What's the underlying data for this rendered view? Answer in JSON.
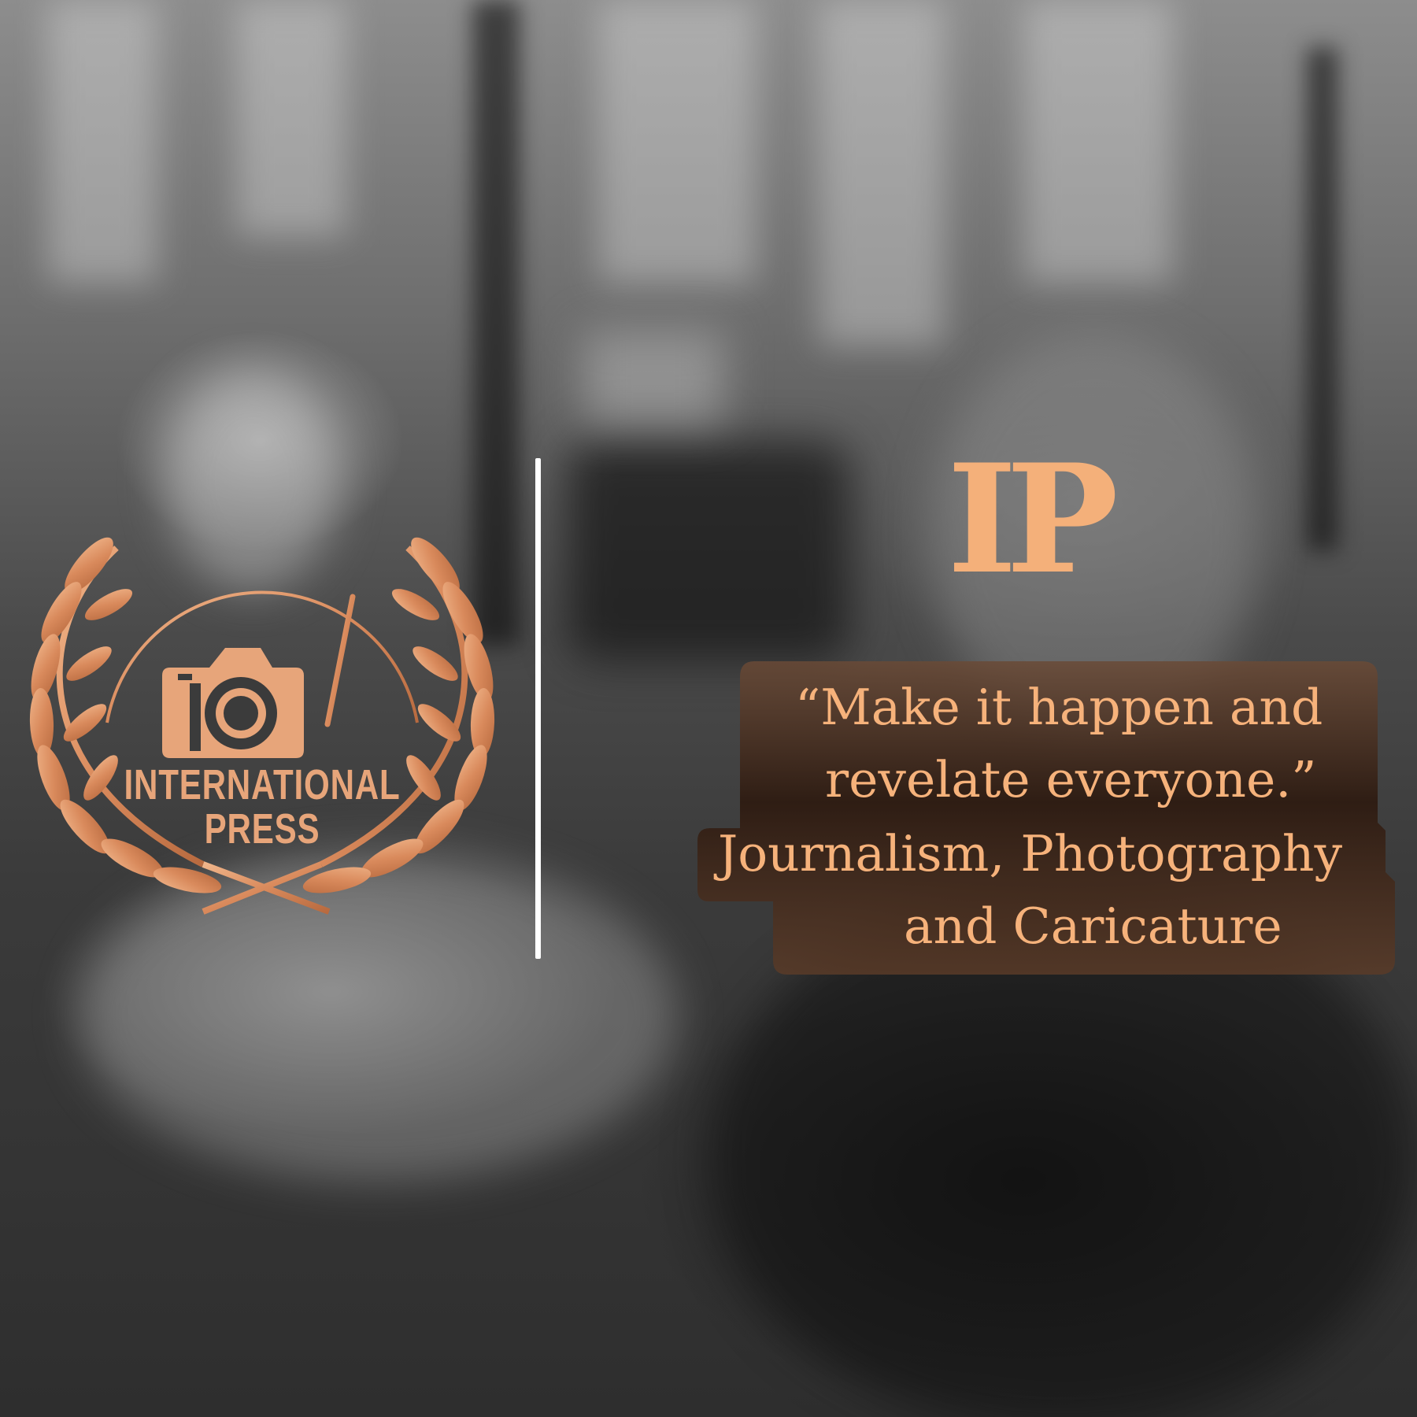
{
  "logo": {
    "line1": "INTERNATIONAL",
    "line2": "PRESS",
    "icon": "camera-icon",
    "wreath": "laurel-wreath-icon",
    "color": "#e7a57a"
  },
  "monogram": "IP",
  "quote": {
    "line1": "“Make it happen and",
    "line2": "revelate everyone.”",
    "line3": "Journalism, Photography",
    "line4": "and Caricature",
    "text_color": "#f6b27b",
    "box_color": "#3a2418"
  },
  "divider_color": "#ffffff"
}
